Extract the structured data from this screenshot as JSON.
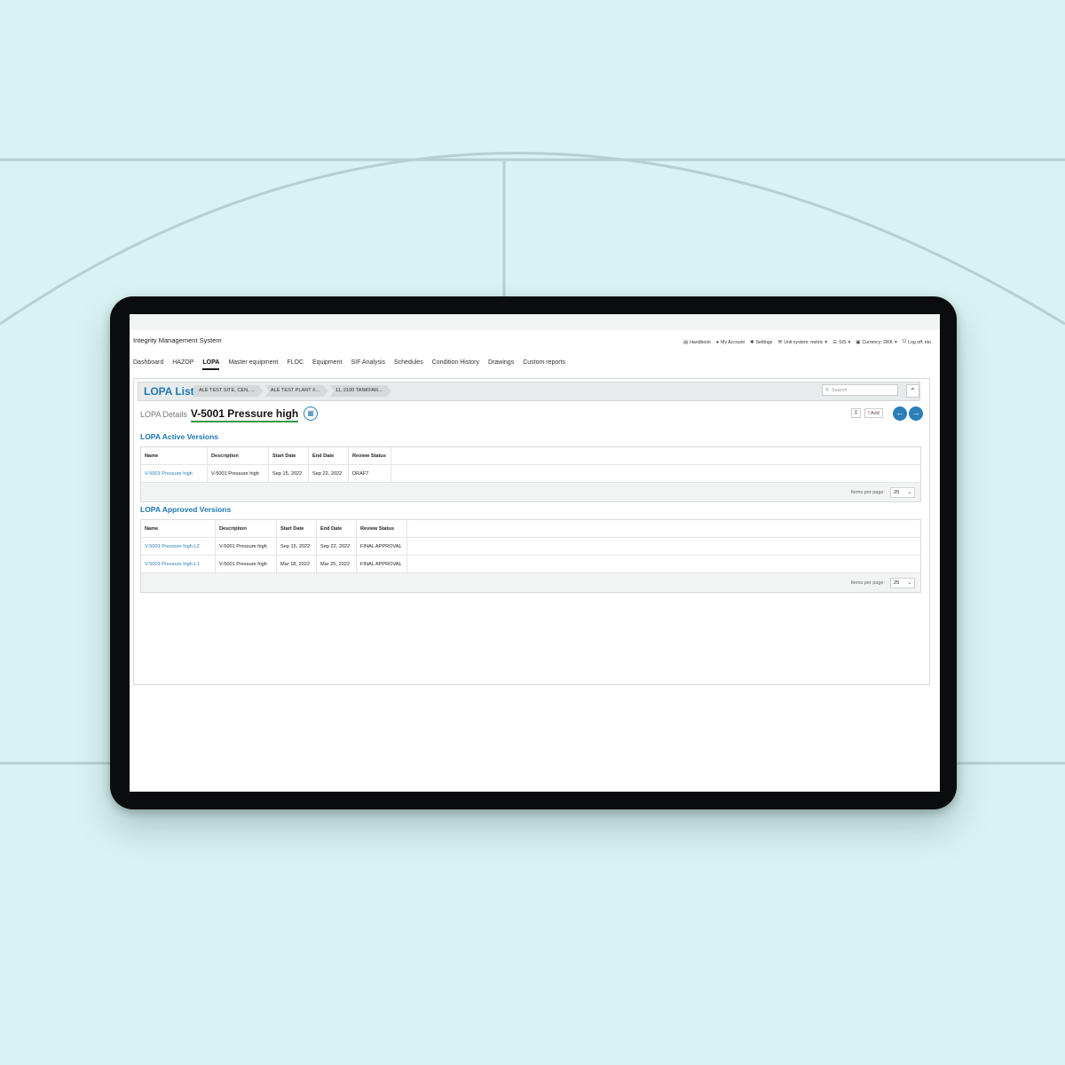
{
  "app": {
    "title": "Integrity Management System"
  },
  "utility_bar": [
    {
      "label": "Handbook",
      "icon": "book-icon"
    },
    {
      "label": "My Account",
      "icon": "user-icon"
    },
    {
      "label": "Settings",
      "icon": "gear-icon"
    },
    {
      "label": "Unit system: metric",
      "icon": "wrench-icon"
    },
    {
      "label": "SIS",
      "icon": "list-icon"
    },
    {
      "label": "Currency: DKK",
      "icon": "money-icon"
    },
    {
      "label": "Log off: eto",
      "icon": "power-icon"
    }
  ],
  "nav": [
    {
      "label": "Dashboard"
    },
    {
      "label": "HAZOP"
    },
    {
      "label": "LOPA",
      "active": true
    },
    {
      "label": "Master equipment"
    },
    {
      "label": "FLOC"
    },
    {
      "label": "Equipment"
    },
    {
      "label": "SIF Analysis"
    },
    {
      "label": "Schedules"
    },
    {
      "label": "Condition History"
    },
    {
      "label": "Drawings"
    },
    {
      "label": "Custom reports"
    }
  ],
  "list": {
    "title": "LOPA List",
    "breadcrumbs": [
      "ALE TEST SITE, CEN, ...",
      "ALE TEST PLANT #...",
      "11, 2100 TANKFAR..."
    ],
    "search_placeholder": "Search"
  },
  "details": {
    "label": "LOPA Details",
    "name": "V-5001 Pressure high",
    "add_label": "Add"
  },
  "active_versions": {
    "title": "LOPA Active Versions",
    "columns": [
      "Name",
      "Description",
      "Start Date",
      "End Date",
      "Review Status"
    ],
    "rows": [
      [
        "V-5001 Pressure high",
        "V-5001 Pressure high",
        "Sep 15, 2022",
        "Sep 22, 2022",
        "DRAFT"
      ]
    ],
    "pager": {
      "label": "Items per page:",
      "value": "25"
    }
  },
  "approved_versions": {
    "title": "LOPA Approved Versions",
    "columns": [
      "Name",
      "Description",
      "Start Date",
      "End Date",
      "Review Status"
    ],
    "rows": [
      [
        "V-5001 Pressure high-L2",
        "V-5001 Pressure high",
        "Sep 15, 2022",
        "Sep 22, 2022",
        "FINAL APPROVAL"
      ],
      [
        "V-5001 Pressure high-L1",
        "V-5001 Pressure high",
        "Mar 18, 2022",
        "Mar 25, 2022",
        "FINAL APPROVAL"
      ]
    ],
    "pager": {
      "label": "Items per page:",
      "value": "25"
    }
  },
  "colors": {
    "accent": "#1e78b4",
    "link": "#2a7fb8",
    "underline": "#2b9a4a",
    "background": "#d9f3f3"
  }
}
